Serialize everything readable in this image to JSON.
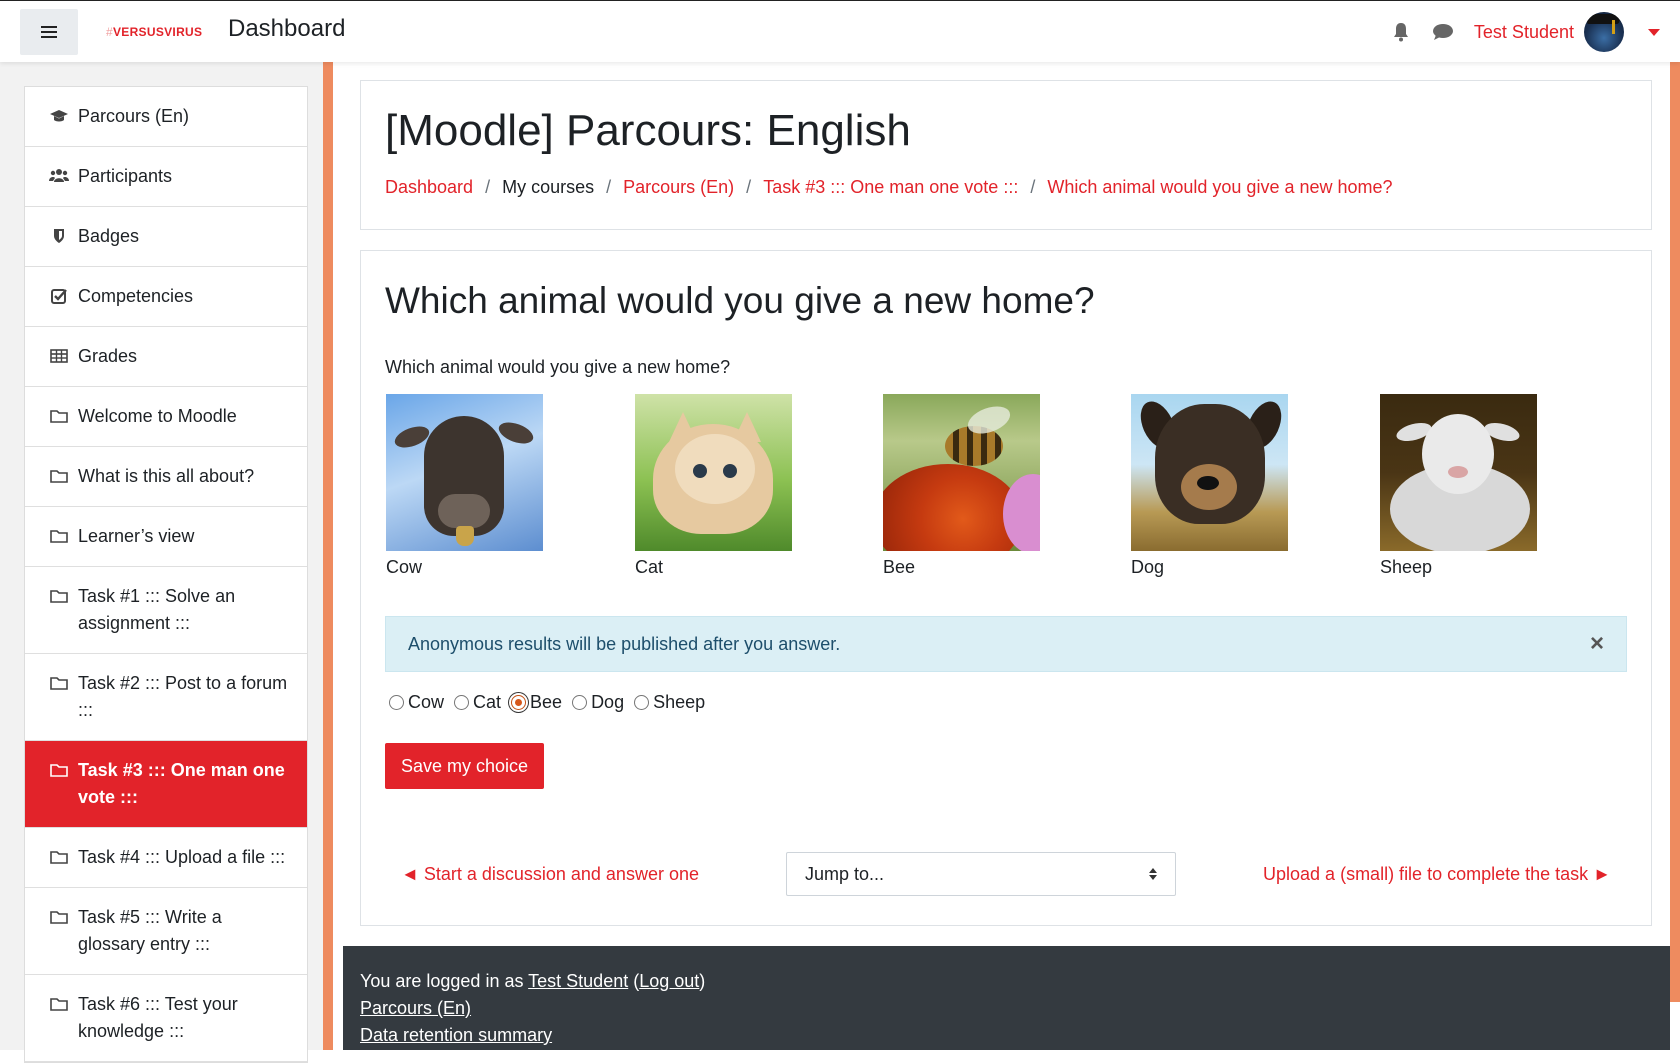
{
  "navbar": {
    "brand_hash": "#",
    "brand": "VERSUSVIRUS",
    "title": "Dashboard",
    "user_name": "Test Student",
    "colors": {
      "accent": "#e2232a",
      "drawer_edge": "#ee8b5f"
    }
  },
  "sidebar": {
    "items": [
      {
        "label": "Parcours (En)",
        "icon": "graduation-cap-icon"
      },
      {
        "label": "Participants",
        "icon": "users-icon"
      },
      {
        "label": "Badges",
        "icon": "shield-icon"
      },
      {
        "label": "Competencies",
        "icon": "check-square-icon"
      },
      {
        "label": "Grades",
        "icon": "table-icon"
      },
      {
        "label": "Welcome to Moodle",
        "icon": "folder-icon"
      },
      {
        "label": "What is this all about?",
        "icon": "folder-icon"
      },
      {
        "label": "Learner’s view",
        "icon": "folder-icon"
      },
      {
        "label": "Task #1 ::: Solve an assignment :::",
        "icon": "folder-icon"
      },
      {
        "label": "Task #2 ::: Post to a forum :::",
        "icon": "folder-icon"
      },
      {
        "label": "Task #3 ::: One man one vote :::",
        "icon": "folder-icon",
        "active": true
      },
      {
        "label": "Task #4 ::: Upload a file :::",
        "icon": "folder-icon"
      },
      {
        "label": "Task #5 ::: Write a glossary entry :::",
        "icon": "folder-icon"
      },
      {
        "label": "Task #6 ::: Test your knowledge :::",
        "icon": "folder-icon"
      }
    ]
  },
  "header": {
    "title": "[Moodle] Parcours: English",
    "breadcrumb": [
      "Dashboard",
      "My courses",
      "Parcours (En)",
      "Task #3 ::: One man one vote :::",
      "Which animal would you give a new home?"
    ],
    "separator": "/"
  },
  "choice": {
    "heading": "Which animal would you give a new home?",
    "question": "Which animal would you give a new home?",
    "animals": [
      "Cow",
      "Cat",
      "Bee",
      "Dog",
      "Sheep"
    ],
    "alert": "Anonymous results will be published after you answer.",
    "close_glyph": "×",
    "options": [
      "Cow",
      "Cat",
      "Bee",
      "Dog",
      "Sheep"
    ],
    "selected": "Bee",
    "save_label": "Save my choice"
  },
  "activity_nav": {
    "prev": "◄ Start a discussion and answer one",
    "jump": "Jump to...",
    "next": "Upload a (small) file to complete the task ►"
  },
  "footer": {
    "logged_in_prefix": "You are logged in as ",
    "user": "Test Student",
    "logout_open": " (",
    "logout": "Log out",
    "logout_close": ")",
    "course_link": "Parcours (En)",
    "data_retention": "Data retention summary"
  }
}
